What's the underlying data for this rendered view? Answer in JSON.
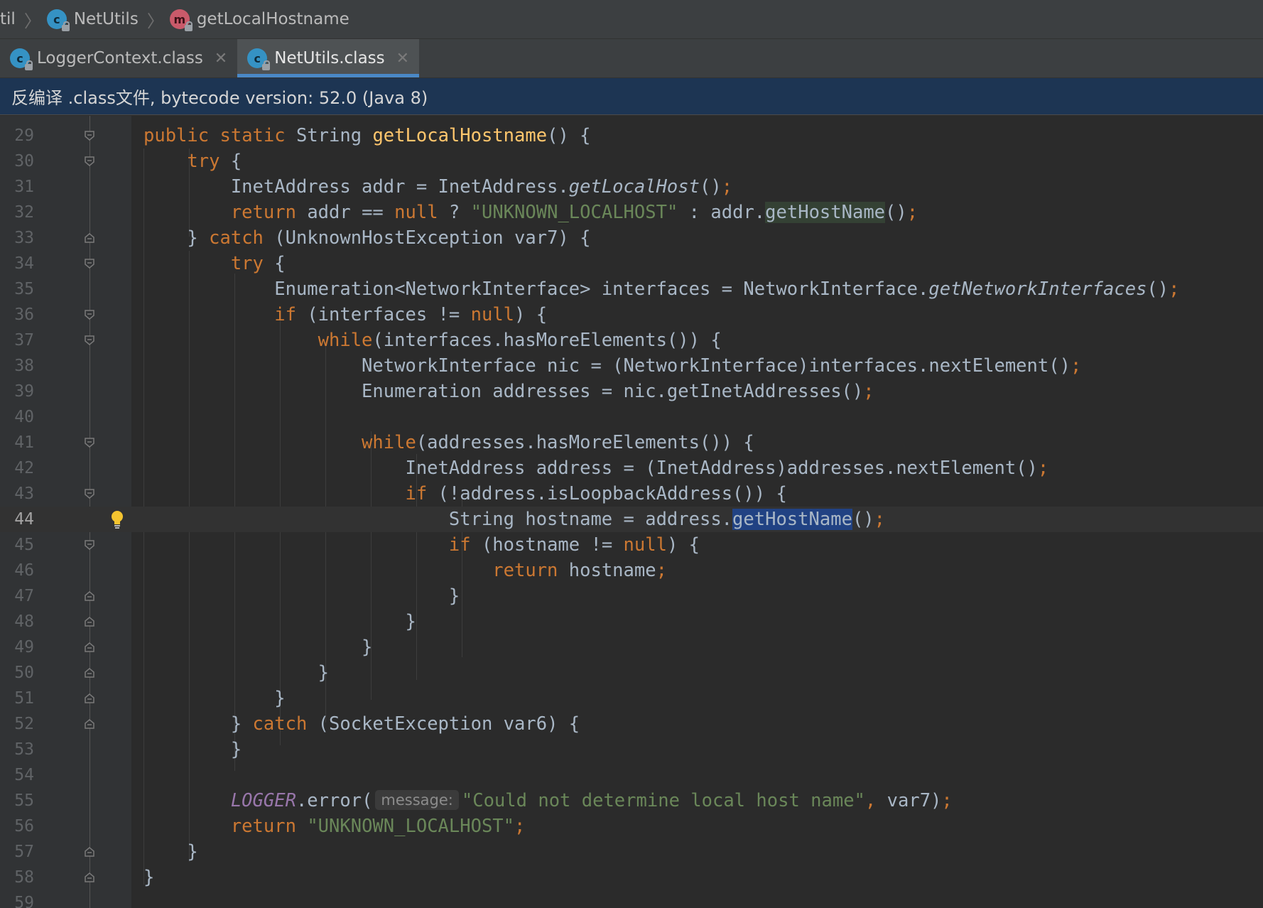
{
  "breadcrumb": {
    "items": [
      {
        "label": "til",
        "icon": ""
      },
      {
        "label": "NetUtils",
        "icon": "class-icon"
      },
      {
        "label": "getLocalHostname",
        "icon": "method-icon"
      }
    ],
    "separator": "〉"
  },
  "tabs": [
    {
      "label": "LoggerContext.class",
      "icon": "class-icon",
      "close": "✕",
      "active": false
    },
    {
      "label": "NetUtils.class",
      "icon": "class-icon",
      "close": "✕",
      "active": true
    }
  ],
  "banner": {
    "text": "反编译 .class文件, bytecode version: 52.0 (Java 8)"
  },
  "editor": {
    "current_line": 44,
    "lines": [
      {
        "n": "29"
      },
      {
        "n": "30"
      },
      {
        "n": "31"
      },
      {
        "n": "32"
      },
      {
        "n": "33"
      },
      {
        "n": "34"
      },
      {
        "n": "35"
      },
      {
        "n": "36"
      },
      {
        "n": "37"
      },
      {
        "n": "38"
      },
      {
        "n": "39"
      },
      {
        "n": "40"
      },
      {
        "n": "41"
      },
      {
        "n": "42"
      },
      {
        "n": "43"
      },
      {
        "n": "44"
      },
      {
        "n": "45"
      },
      {
        "n": "46"
      },
      {
        "n": "47"
      },
      {
        "n": "48"
      },
      {
        "n": "49"
      },
      {
        "n": "50"
      },
      {
        "n": "51"
      },
      {
        "n": "52"
      },
      {
        "n": "53"
      },
      {
        "n": "54"
      },
      {
        "n": "55"
      },
      {
        "n": "56"
      },
      {
        "n": "57"
      },
      {
        "n": "58"
      },
      {
        "n": "59"
      }
    ],
    "tokens": {
      "public": "public",
      "static": "static",
      "String": "String",
      "getLocalHostname": "getLocalHostname",
      "open_sig": "() {",
      "try": "try",
      "open_brace": "{",
      "close_brace": "}",
      "InetAddress_addr": "InetAddress addr = InetAddress.",
      "getLocalHost": "getLocalHost",
      "paren_empty": "()",
      "semi": ";",
      "return": "return",
      "addr_eq": "addr == ",
      "null": "null",
      "q": " ? ",
      "UNKNOWN_LOCALHOST": "\"UNKNOWN_LOCALHOST\"",
      "colon_addr": " : addr.",
      "getHostName": "getHostName",
      "catch": "catch",
      "unknown_ex": "(UnknownHostException var7) {",
      "enum_ifaces": "Enumeration<NetworkInterface> interfaces = NetworkInterface.",
      "getNetworkInterfaces": "getNetworkInterfaces",
      "if": "if",
      "ifaces_neq": "(interfaces != ",
      "close_paren_brace": ") {",
      "while": "while",
      "ifaces_more": "(interfaces.hasMoreElements()) {",
      "nic_line": "NetworkInterface nic = (NetworkInterface)interfaces.nextElement()",
      "enum_addrs": "Enumeration addresses = nic.getInetAddresses()",
      "addrs_more": "(addresses.hasMoreElements()) {",
      "address_line": "InetAddress address = (InetAddress)addresses.nextElement()",
      "loopback": "(!address.isLoopbackAddress()) {",
      "hostname_line": "String hostname = address.",
      "hostname_neq": "(hostname != ",
      "hostname": "hostname",
      "socket_ex": "(SocketException var6) {",
      "LOGGER": "LOGGER",
      "error_call": ".error(",
      "message_hint": "message:",
      "could_not": "\"Could not determine local host name\"",
      "comma": ",",
      "var7_end": " var7)"
    }
  },
  "colors": {
    "keyword": "#cc7832",
    "string": "#6a8759",
    "function": "#ffc66d",
    "identifier": "#a9b7c6",
    "static_field": "#9876aa",
    "banner_bg": "#1d3553",
    "tab_underline": "#4a88c7",
    "selection": "#214283",
    "bulb": "#f4c430"
  }
}
